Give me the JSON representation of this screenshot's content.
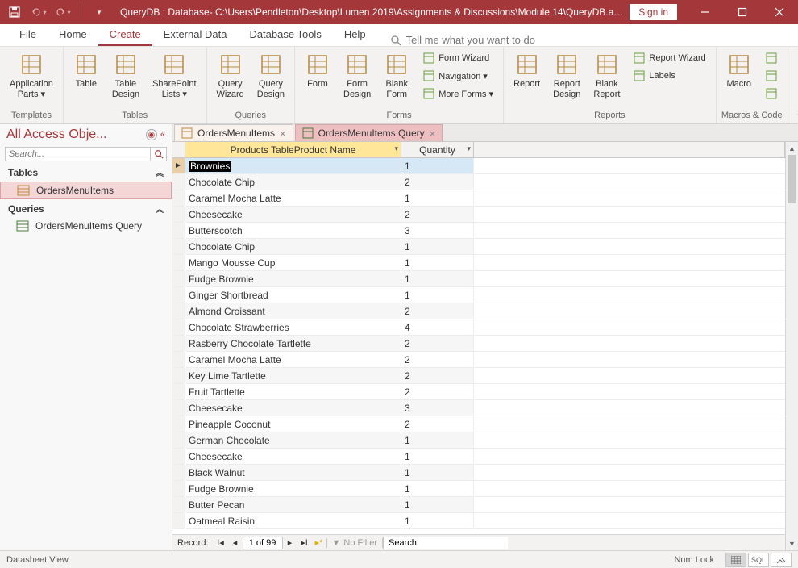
{
  "titlebar": {
    "app_title": "QueryDB : Database- C:\\Users\\Pendleton\\Desktop\\Lumen 2019\\Assignments & Discussions\\Module 14\\QueryDB.ac...",
    "signin": "Sign in"
  },
  "menu": {
    "tabs": [
      "File",
      "Home",
      "Create",
      "External Data",
      "Database Tools",
      "Help"
    ],
    "active": "Create",
    "tellme": "Tell me what you want to do"
  },
  "ribbon": {
    "groups": [
      {
        "label": "Templates",
        "items": [
          {
            "label": "Application\nParts ▾"
          }
        ]
      },
      {
        "label": "Tables",
        "items": [
          {
            "label": "Table"
          },
          {
            "label": "Table\nDesign"
          },
          {
            "label": "SharePoint\nLists ▾"
          }
        ]
      },
      {
        "label": "Queries",
        "items": [
          {
            "label": "Query\nWizard"
          },
          {
            "label": "Query\nDesign"
          }
        ]
      },
      {
        "label": "Forms",
        "items": [
          {
            "label": "Form"
          },
          {
            "label": "Form\nDesign"
          },
          {
            "label": "Blank\nForm"
          }
        ],
        "small": [
          "Form Wizard",
          "Navigation ▾",
          "More Forms ▾"
        ]
      },
      {
        "label": "Reports",
        "items": [
          {
            "label": "Report"
          },
          {
            "label": "Report\nDesign"
          },
          {
            "label": "Blank\nReport"
          }
        ],
        "small": [
          "Report Wizard",
          "Labels"
        ]
      },
      {
        "label": "Macros & Code",
        "items": [
          {
            "label": "Macro"
          }
        ]
      }
    ]
  },
  "navpane": {
    "title": "All Access Obje...",
    "search_placeholder": "Search...",
    "sections": [
      {
        "title": "Tables",
        "items": [
          {
            "label": "OrdersMenuItems",
            "selected": true,
            "type": "table"
          }
        ]
      },
      {
        "title": "Queries",
        "items": [
          {
            "label": "OrdersMenuItems Query",
            "selected": false,
            "type": "query"
          }
        ]
      }
    ]
  },
  "doctabs": [
    {
      "label": "OrdersMenuItems",
      "active": false,
      "type": "table"
    },
    {
      "label": "OrdersMenuItems Query",
      "active": true,
      "type": "query"
    }
  ],
  "datasheet": {
    "columns": [
      "Products TableProduct Name",
      "Quantity"
    ],
    "rows": [
      {
        "product": "Brownies",
        "qty": 1,
        "selected": true
      },
      {
        "product": "Chocolate Chip",
        "qty": 2
      },
      {
        "product": "Caramel Mocha Latte",
        "qty": 1
      },
      {
        "product": "Cheesecake",
        "qty": 2
      },
      {
        "product": "Butterscotch",
        "qty": 3
      },
      {
        "product": "Chocolate Chip",
        "qty": 1
      },
      {
        "product": "Mango Mousse Cup",
        "qty": 1
      },
      {
        "product": "Fudge Brownie",
        "qty": 1
      },
      {
        "product": "Ginger Shortbread",
        "qty": 1
      },
      {
        "product": "Almond Croissant",
        "qty": 2
      },
      {
        "product": "Chocolate Strawberries",
        "qty": 4
      },
      {
        "product": "Rasberry Chocolate Tartlette",
        "qty": 2
      },
      {
        "product": "Caramel Mocha Latte",
        "qty": 2
      },
      {
        "product": "Key Lime Tartlette",
        "qty": 2
      },
      {
        "product": "Fruit Tartlette",
        "qty": 2
      },
      {
        "product": "Cheesecake",
        "qty": 3
      },
      {
        "product": "Pineapple Coconut",
        "qty": 2
      },
      {
        "product": "German Chocolate",
        "qty": 1
      },
      {
        "product": "Cheesecake",
        "qty": 1
      },
      {
        "product": "Black Walnut",
        "qty": 1
      },
      {
        "product": "Fudge Brownie",
        "qty": 1
      },
      {
        "product": "Butter Pecan",
        "qty": 1
      },
      {
        "product": "Oatmeal Raisin",
        "qty": 1
      }
    ]
  },
  "recnav": {
    "label": "Record:",
    "position": "1 of 99",
    "filter": "No Filter",
    "search": "Search"
  },
  "statusbar": {
    "view": "Datasheet View",
    "numlock": "Num Lock",
    "sql": "SQL"
  },
  "colors": {
    "accent": "#a4373a",
    "highlight_col": "#ffe699",
    "selected_row": "#d6e8f5",
    "nav_selected": "#f5d6d7"
  }
}
